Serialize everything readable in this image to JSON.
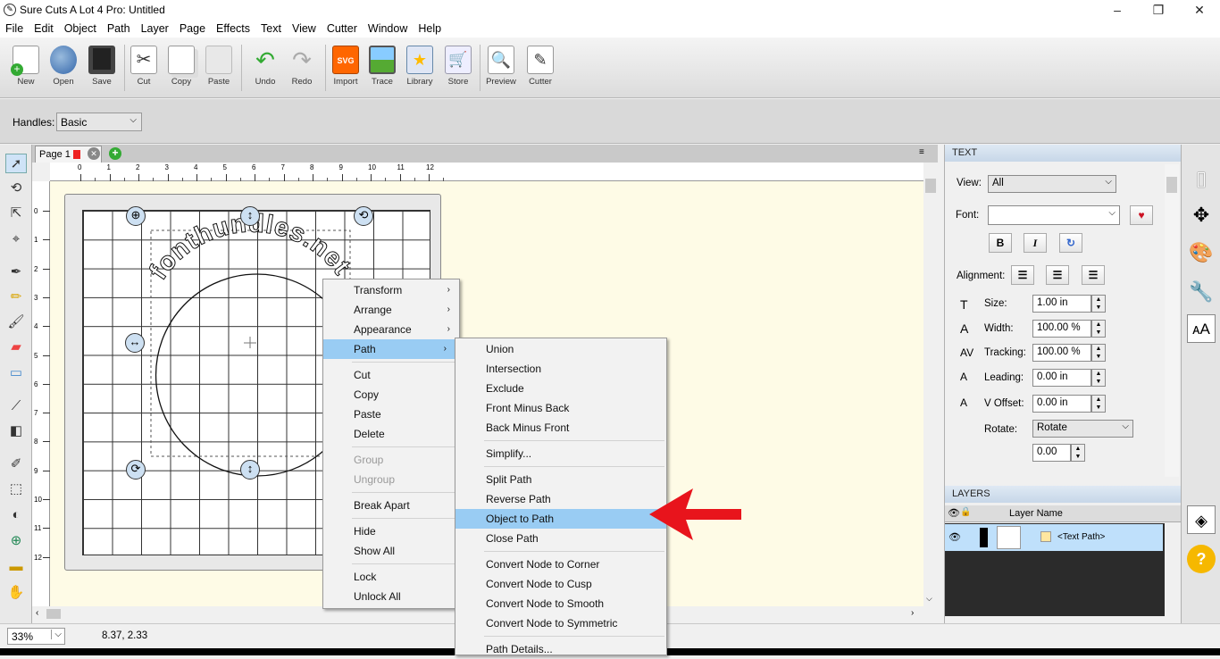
{
  "window": {
    "title": "Sure Cuts A Lot 4 Pro: Untitled"
  },
  "menubar": [
    "File",
    "Edit",
    "Object",
    "Path",
    "Layer",
    "Page",
    "Effects",
    "Text",
    "View",
    "Cutter",
    "Window",
    "Help"
  ],
  "toolbar": [
    {
      "label": "New",
      "icon": "new-document-icon"
    },
    {
      "label": "Open",
      "icon": "open-icon"
    },
    {
      "label": "Save",
      "icon": "save-icon"
    },
    {
      "label": "Cut",
      "icon": "cut-icon"
    },
    {
      "label": "Copy",
      "icon": "copy-icon"
    },
    {
      "label": "Paste",
      "icon": "paste-icon"
    },
    {
      "label": "Undo",
      "icon": "undo-icon"
    },
    {
      "label": "Redo",
      "icon": "redo-icon"
    },
    {
      "label": "Import",
      "icon": "import-svg-icon"
    },
    {
      "label": "Trace",
      "icon": "trace-icon"
    },
    {
      "label": "Library",
      "icon": "library-icon"
    },
    {
      "label": "Store",
      "icon": "store-icon"
    },
    {
      "label": "Preview",
      "icon": "preview-icon"
    },
    {
      "label": "Cutter",
      "icon": "cutter-icon"
    }
  ],
  "handles": {
    "label": "Handles:",
    "value": "Basic"
  },
  "tab": {
    "label": "Page 1"
  },
  "ruler_h": [
    "0",
    "1",
    "2",
    "3",
    "4",
    "5",
    "6",
    "7",
    "8",
    "9",
    "10",
    "11",
    "12"
  ],
  "ruler_v": [
    "0",
    "1",
    "2",
    "3",
    "4",
    "5",
    "6",
    "7",
    "8",
    "9",
    "10",
    "11",
    "12"
  ],
  "canvas": {
    "text_on_path": "fonthundles.net"
  },
  "context_menu": {
    "items": [
      {
        "label": "Transform",
        "sub": true
      },
      {
        "label": "Arrange",
        "sub": true
      },
      {
        "label": "Appearance",
        "sub": true
      },
      {
        "label": "Path",
        "sub": true,
        "highlight": true
      },
      {
        "label": "Cut"
      },
      {
        "label": "Copy"
      },
      {
        "label": "Paste"
      },
      {
        "label": "Delete"
      },
      {
        "label": "Group",
        "disabled": true
      },
      {
        "label": "Ungroup",
        "disabled": true
      },
      {
        "label": "Break Apart"
      },
      {
        "label": "Hide"
      },
      {
        "label": "Show All"
      },
      {
        "label": "Lock"
      },
      {
        "label": "Unlock All"
      }
    ]
  },
  "path_submenu": {
    "items": [
      {
        "label": "Union"
      },
      {
        "label": "Intersection"
      },
      {
        "label": "Exclude"
      },
      {
        "label": "Front Minus Back"
      },
      {
        "label": "Back Minus Front"
      },
      {
        "label": "Simplify..."
      },
      {
        "label": "Split Path"
      },
      {
        "label": "Reverse Path"
      },
      {
        "label": "Object to Path",
        "highlight": true
      },
      {
        "label": "Close Path"
      },
      {
        "label": "Convert Node to Corner"
      },
      {
        "label": "Convert Node to Cusp"
      },
      {
        "label": "Convert Node to Smooth"
      },
      {
        "label": "Convert Node to Symmetric"
      },
      {
        "label": "Path Details..."
      }
    ]
  },
  "text_panel": {
    "header": "TEXT",
    "view_label": "View:",
    "view_value": "All",
    "font_label": "Font:",
    "font_value": "",
    "alignment_label": "Alignment:",
    "size_label": "Size:",
    "size_value": "1.00 in",
    "width_label": "Width:",
    "width_value": "100.00 %",
    "tracking_label": "Tracking:",
    "tracking_value": "100.00 %",
    "leading_label": "Leading:",
    "leading_value": "0.00 in",
    "voffset_label": "V Offset:",
    "voffset_value": "0.00 in",
    "rotate_label": "Rotate:",
    "rotate_value": "Rotate",
    "rotate_amount": "0.00",
    "bold": "B",
    "italic": "I"
  },
  "layers_panel": {
    "header": "LAYERS",
    "column": "Layer Name",
    "layer": "<Text Path>"
  },
  "status": {
    "zoom": "33%",
    "coords": "8.37, 2.33"
  },
  "colors": {
    "highlight": "#99ccf3",
    "arrow": "#e8141c",
    "panel_header": "#c7d7e8",
    "canvas_bg": "#fefbe6"
  }
}
